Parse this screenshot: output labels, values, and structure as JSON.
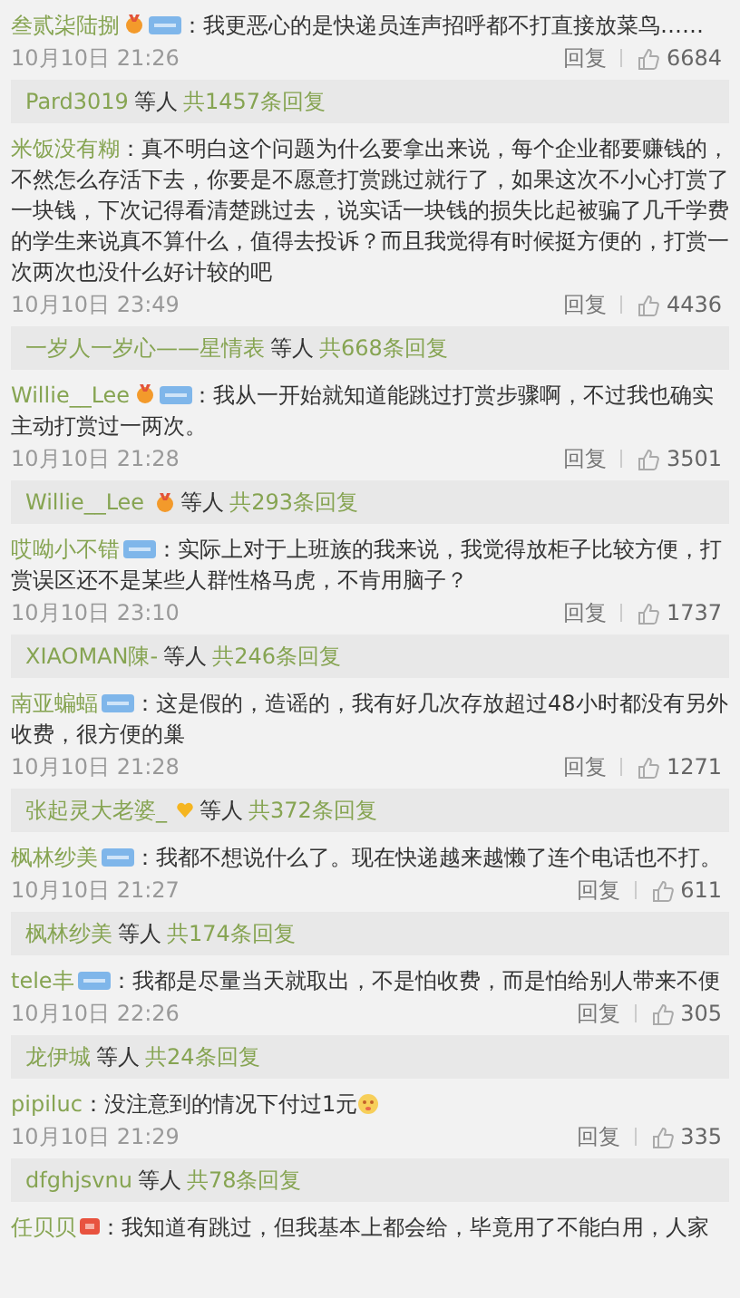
{
  "comments": [
    {
      "name": "叁贰柒陆捌",
      "badges": [
        {
          "kind": "medal"
        },
        {
          "kind": "level"
        }
      ],
      "text": "：我更恶心的是快递员连声招呼都不打直接放菜鸟……",
      "time": "10月10日 21:26",
      "reply_label": "回复",
      "likes": "6684",
      "thread": {
        "names": "Pard3019",
        "others": "等人",
        "count": "共1457条回复"
      }
    },
    {
      "name": "米饭没有糊",
      "text": "：真不明白这个问题为什么要拿出来说，每个企业都要赚钱的，不然怎么存活下去，你要是不愿意打赏跳过就行了，如果这次不小心打赏了一块钱，下次记得看清楚跳过去，说实话一块钱的损失比起被骗了几千学费的学生来说真不算什么，值得去投诉？而且我觉得有时候挺方便的，打赏一次两次也没什么好计较的吧",
      "time": "10月10日 23:49",
      "reply_label": "回复",
      "likes": "4436",
      "thread": {
        "names": "一岁人一岁心——星情表",
        "others": "等人",
        "count": "共668条回复"
      }
    },
    {
      "name": "Willie__Lee",
      "badges": [
        {
          "kind": "medal"
        },
        {
          "kind": "level"
        }
      ],
      "text": "：我从一开始就知道能跳过打赏步骤啊，不过我也确实主动打赏过一两次。",
      "time": "10月10日 21:28",
      "reply_label": "回复",
      "likes": "3501",
      "thread": {
        "names": "Willie__Lee",
        "badges": [
          {
            "kind": "medal"
          }
        ],
        "others": "等人",
        "count": "共293条回复"
      }
    },
    {
      "name": "哎呦小不错",
      "badges": [
        {
          "kind": "level"
        }
      ],
      "text": "：实际上对于上班族的我来说，我觉得放柜子比较方便，打赏误区还不是某些人群性格马虎，不肯用脑子？",
      "time": "10月10日 23:10",
      "reply_label": "回复",
      "likes": "1737",
      "thread": {
        "names": "XIAOMAN陳-",
        "others": "等人",
        "count": "共246条回复"
      }
    },
    {
      "name": "南亚蝙蝠",
      "badges": [
        {
          "kind": "level"
        }
      ],
      "text": "：这是假的，造谣的，我有好几次存放超过48小时都没有另外收费，很方便的巢",
      "time": "10月10日 21:28",
      "reply_label": "回复",
      "likes": "1271",
      "thread": {
        "names": "张起灵大老婆_",
        "badges": [
          {
            "kind": "heart"
          }
        ],
        "others": "等人",
        "count": "共372条回复"
      }
    },
    {
      "name": "枫林纱美",
      "badges": [
        {
          "kind": "level"
        }
      ],
      "text": "：我都不想说什么了。现在快递越来越懒了连个电话也不打。",
      "time": "10月10日 21:27",
      "reply_label": "回复",
      "likes": "611",
      "thread": {
        "names": "枫林纱美",
        "others": "等人",
        "count": "共174条回复"
      }
    },
    {
      "name": "tele丰",
      "badges": [
        {
          "kind": "level"
        }
      ],
      "text": "：我都是尽量当天就取出，不是怕收费，而是怕给别人带来不便",
      "time": "10月10日 22:26",
      "reply_label": "回复",
      "likes": "305",
      "thread": {
        "names": "龙伊城",
        "others": "等人",
        "count": "共24条回复"
      }
    },
    {
      "name": "pipiluc",
      "text": "：没注意到的情况下付过1元",
      "emoji": true,
      "time": "10月10日 21:29",
      "reply_label": "回复",
      "likes": "335",
      "thread": {
        "names": "dfghjsvnu",
        "others": "等人",
        "count": "共78条回复"
      }
    },
    {
      "name": "任贝贝",
      "badges": [
        {
          "kind": "red"
        }
      ],
      "text": "：我知道有跳过，但我基本上都会给，毕竟用了不能白用，人家"
    }
  ]
}
